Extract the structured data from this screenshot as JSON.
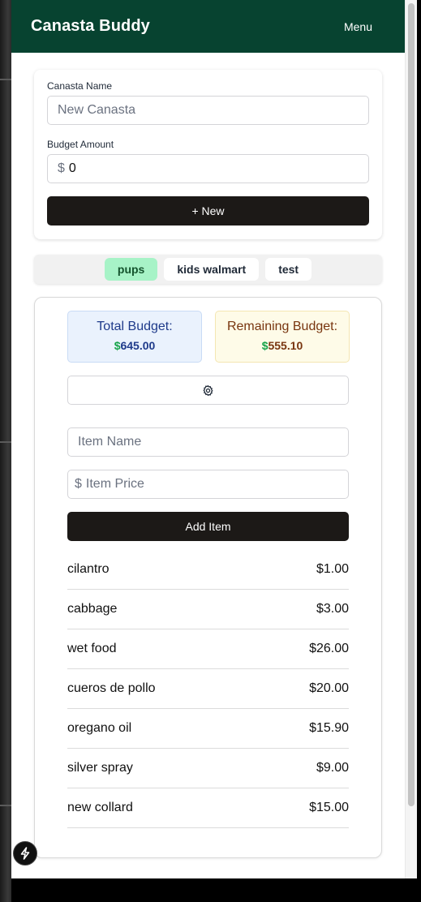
{
  "app": {
    "title": "Canasta Buddy",
    "menu_label": "Menu"
  },
  "form": {
    "name_label": "Canasta Name",
    "name_placeholder": "New Canasta",
    "budget_label": "Budget Amount",
    "currency_symbol": "$",
    "budget_value": "0",
    "new_button": "+ New"
  },
  "tabs": [
    {
      "label": "pups",
      "active": true
    },
    {
      "label": "kids walmart",
      "active": false
    },
    {
      "label": "test",
      "active": false
    }
  ],
  "summary": {
    "total_label": "Total Budget:",
    "total_currency": "$",
    "total_value": "645.00",
    "remaining_label": "Remaining Budget:",
    "remaining_currency": "$",
    "remaining_value": "555.10"
  },
  "settings_icon": "gear-icon",
  "add_item": {
    "name_placeholder": "Item Name",
    "currency_symbol": "$",
    "price_placeholder": "Item Price",
    "button": "Add Item"
  },
  "items": [
    {
      "name": "cilantro",
      "price": "$1.00"
    },
    {
      "name": "cabbage",
      "price": "$3.00"
    },
    {
      "name": "wet food",
      "price": "$26.00"
    },
    {
      "name": "cueros de pollo",
      "price": "$20.00"
    },
    {
      "name": "oregano oil",
      "price": "$15.90"
    },
    {
      "name": "silver spray",
      "price": "$9.00"
    },
    {
      "name": "new collard",
      "price": "$15.00"
    }
  ],
  "floating_button_icon": "lightning-icon",
  "colors": {
    "header": "#074330",
    "active_tab": "#a7f3c7",
    "dollar_green": "#16a34a",
    "dark_button": "#1c1917"
  }
}
